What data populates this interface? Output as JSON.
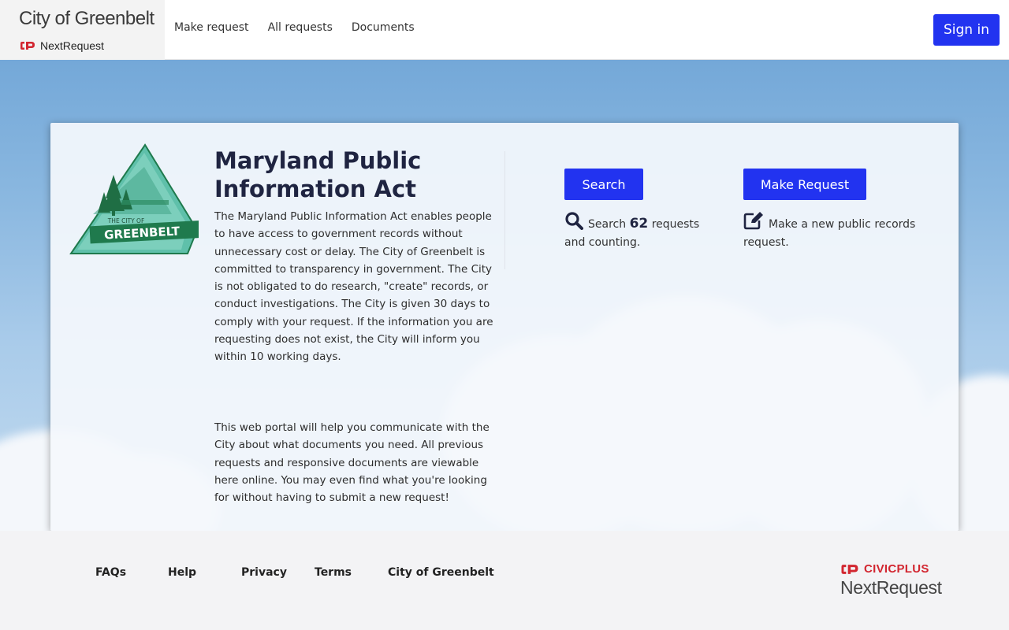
{
  "header": {
    "site_title": "City of Greenbelt",
    "platform": "NextRequest",
    "nav": [
      {
        "label": "Make request"
      },
      {
        "label": "All requests"
      },
      {
        "label": "Documents"
      }
    ],
    "sign_in_label": "Sign in"
  },
  "main": {
    "logo_text_top": "THE CITY OF",
    "logo_text_main": "GREENBELT",
    "title": "Maryland Public Information Act",
    "description_1": "The Maryland Public Information Act enables people to have access to government records without unnecessary cost or delay. The City of Greenbelt is committed to transparency in government. The City is not obligated to do research, \"create\" records, or conduct investigations. The City is given 30 days to comply with your request. If the information you are requesting does not exist, the City will inform you within 10 working days.",
    "description_2": "This web portal will help you communicate with the City about what documents you need. All previous requests and responsive documents are viewable here online. You may even find what you're looking for without having to submit a new request!",
    "search": {
      "button_label": "Search",
      "text_before": "Search",
      "count": "62",
      "text_after": "requests and counting.",
      "icon": "search-icon"
    },
    "make_request": {
      "button_label": "Make Request",
      "text": "Make a new public records request.",
      "icon": "edit-icon"
    }
  },
  "footer": {
    "links": [
      {
        "label": "FAQs"
      },
      {
        "label": "Help"
      },
      {
        "label": "Privacy"
      },
      {
        "label": "Terms"
      },
      {
        "label": "City of Greenbelt"
      }
    ],
    "brand_top": "CIVICPLUS",
    "brand_bottom": "NextRequest"
  },
  "colors": {
    "accent": "#2233f0",
    "title": "#1f2441",
    "civicplus_red": "#d22630",
    "logo_green": "#1f7a4d",
    "logo_teal": "#5fc0aa"
  }
}
